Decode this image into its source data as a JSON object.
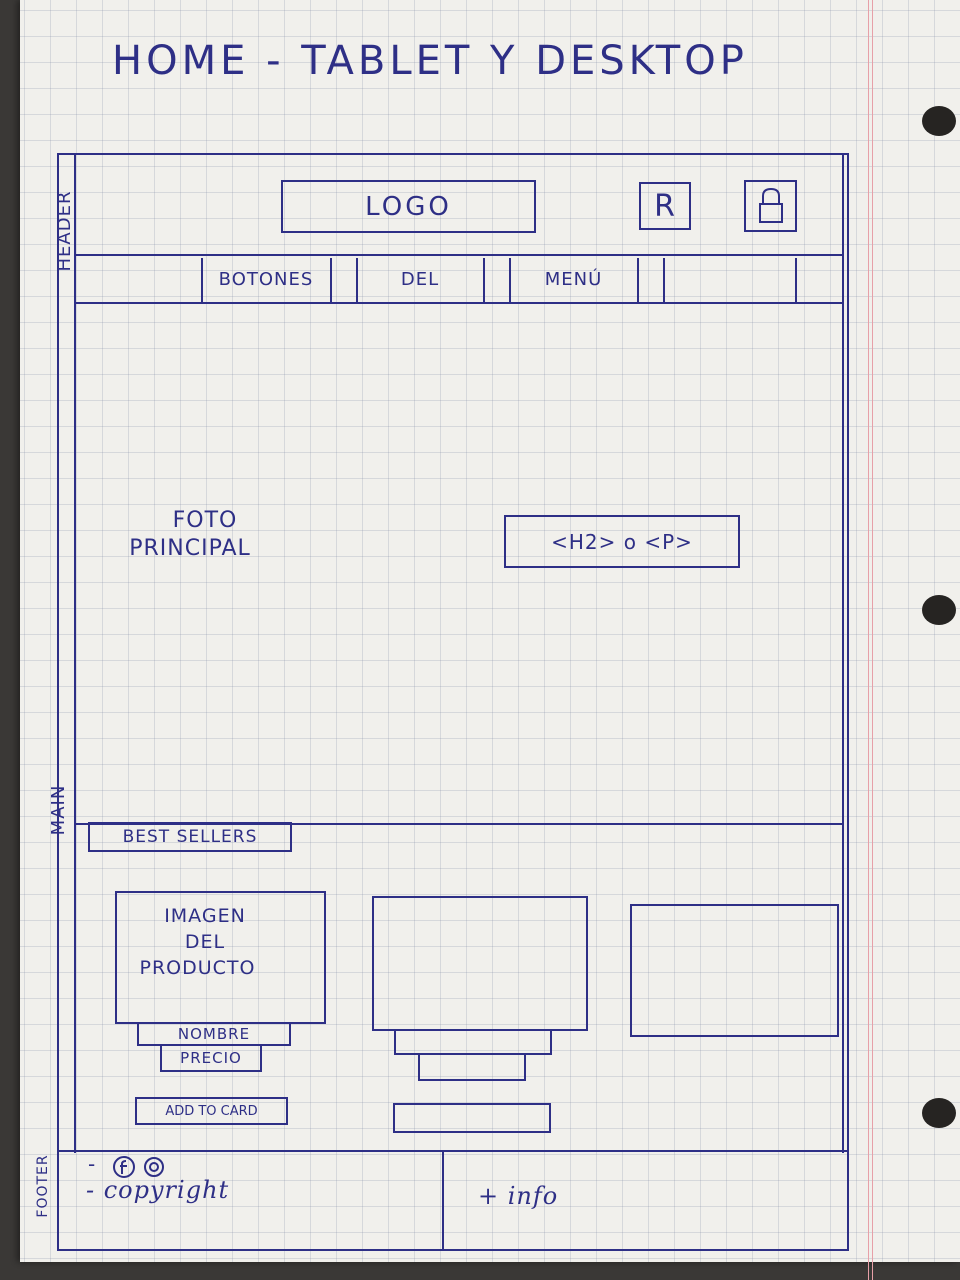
{
  "title": "HOME - TABLET Y DESKTOP",
  "side_labels": {
    "header": "HEADER",
    "main": "MAIN",
    "footer": "FOOTER"
  },
  "header": {
    "logo": "LOGO",
    "icon_r": "R",
    "icon_lock": "lock-icon",
    "nav": [
      "BOTONES",
      "DEL",
      "MENÚ"
    ]
  },
  "hero": {
    "photo_label_1": "FOTO",
    "photo_label_2": "PRINCIPAL",
    "text_box": "<H2> o <P>"
  },
  "best_sellers": {
    "heading": "BEST SELLERS",
    "product_image_1": "IMAGEN",
    "product_image_2": "DEL",
    "product_image_3": "PRODUCTO",
    "name": "NOMBRE",
    "price": "PRECIO",
    "add_to_cart": "ADD TO CARD"
  },
  "footer": {
    "social_icons": [
      "facebook-icon",
      "instagram-icon"
    ],
    "social_dash": "-",
    "copyright": "- copyright",
    "more_info": "+ info"
  },
  "colors": {
    "ink": "#2e2f86",
    "paper": "#f1f0ec",
    "grid": "#b5bccd",
    "margin": "#e7a0a8"
  }
}
